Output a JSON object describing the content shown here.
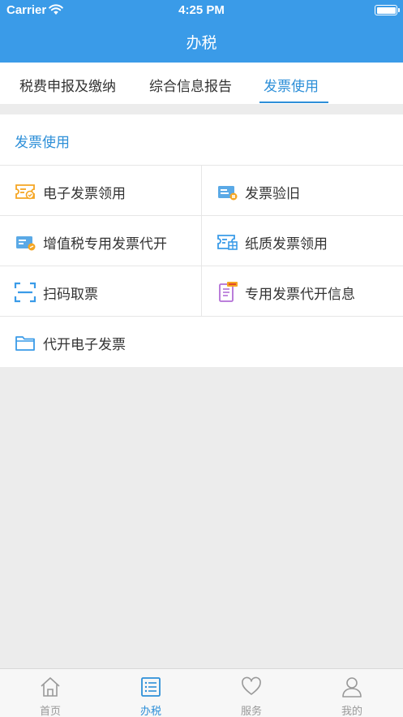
{
  "status_bar": {
    "carrier": "Carrier",
    "time": "4:25 PM"
  },
  "header": {
    "title": "办税"
  },
  "tabs": [
    {
      "label": "税费申报及缴纳",
      "active": false
    },
    {
      "label": "综合信息报告",
      "active": false
    },
    {
      "label": "发票使用",
      "active": true
    }
  ],
  "section": {
    "title": "发票使用",
    "items": [
      {
        "label": "电子发票领用",
        "icon": "e-invoice-ticket-icon"
      },
      {
        "label": "发票验旧",
        "icon": "invoice-verify-icon"
      },
      {
        "label": "增值税专用发票代开",
        "icon": "vat-invoice-icon"
      },
      {
        "label": "纸质发票领用",
        "icon": "paper-invoice-icon"
      },
      {
        "label": "扫码取票",
        "icon": "scan-icon"
      },
      {
        "label": "专用发票代开信息",
        "icon": "special-invoice-info-icon"
      },
      {
        "label": "代开电子发票",
        "icon": "folder-icon"
      }
    ]
  },
  "tabbar": [
    {
      "label": "首页",
      "icon": "home-icon",
      "active": false
    },
    {
      "label": "办税",
      "icon": "list-icon",
      "active": true
    },
    {
      "label": "服务",
      "icon": "heart-icon",
      "active": false
    },
    {
      "label": "我的",
      "icon": "user-icon",
      "active": false
    }
  ],
  "colors": {
    "primary": "#3a9be8",
    "accent": "#2d8fd8",
    "orange": "#f5a623"
  }
}
